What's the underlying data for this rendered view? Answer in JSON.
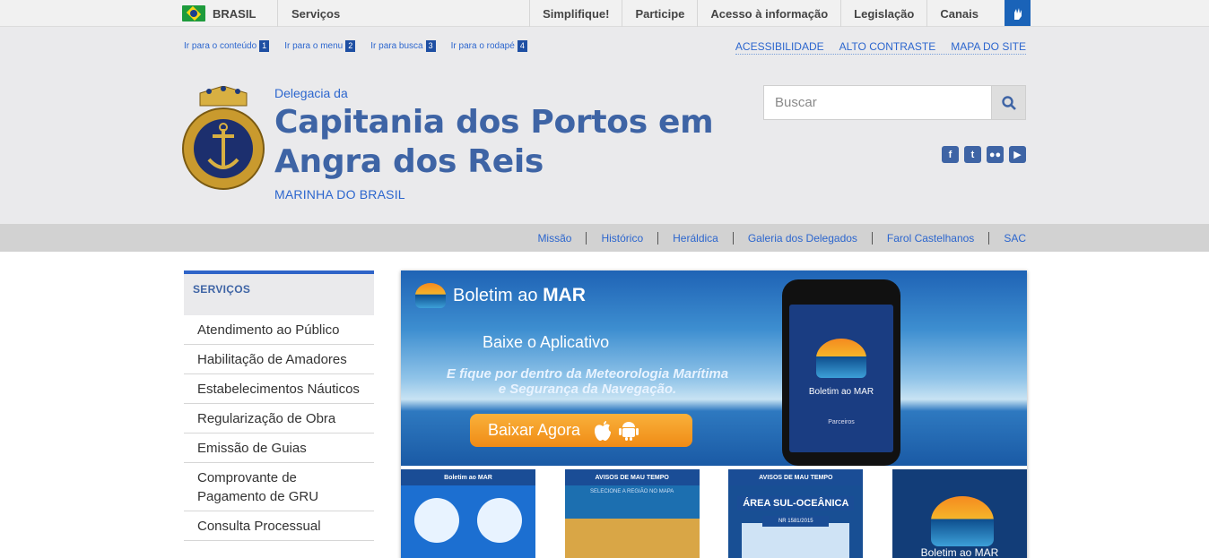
{
  "govbar": {
    "country_label": "BRASIL",
    "services_label": "Serviços",
    "links": [
      "Simplifique!",
      "Participe",
      "Acesso à informação",
      "Legislação",
      "Canais"
    ],
    "accessibility_icon": "sign-language-icon"
  },
  "shortcuts": [
    {
      "label": "Ir para o conteúdo",
      "key": "1"
    },
    {
      "label": "Ir para o menu",
      "key": "2"
    },
    {
      "label": "Ir para busca",
      "key": "3"
    },
    {
      "label": "Ir para o rodapé",
      "key": "4"
    }
  ],
  "accessibility_links": [
    "ACESSIBILIDADE",
    "ALTO CONTRASTE",
    "MAPA DO SITE"
  ],
  "site": {
    "subtitle": "Delegacia da",
    "title_line1": "Capitania dos Portos em",
    "title_line2": "Angra dos Reis",
    "organization": "MARINHA DO BRASIL",
    "logo_icon": "marinha-do-brasil-crest-icon"
  },
  "search": {
    "placeholder": "Buscar",
    "value": "",
    "button_icon": "search-icon"
  },
  "social": [
    {
      "name": "facebook-icon",
      "glyph": "f"
    },
    {
      "name": "twitter-icon",
      "glyph": "t"
    },
    {
      "name": "flickr-icon",
      "glyph": "●●"
    },
    {
      "name": "youtube-icon",
      "glyph": "▶"
    }
  ],
  "subnav": [
    "Missão",
    "Histórico",
    "Heráldica",
    "Galeria dos Delegados",
    "Farol Castelhanos",
    "SAC"
  ],
  "sidebar": {
    "heading": "SERVIÇOS",
    "items": [
      "Atendimento ao Público",
      "Habilitação de Amadores",
      "Estabelecimentos Náuticos",
      "Regularização de Obra",
      "Emissão de Guias",
      "Comprovante de Pagamento de GRU",
      "Consulta Processual"
    ]
  },
  "banner": {
    "brand_prefix": "Boletim ao ",
    "brand_strong": "MAR",
    "download_heading": "Baixe o Aplicativo",
    "description_line1": "E fique por dentro da Meteorologia Marítima",
    "description_line2": "e Segurança da Navegação.",
    "cta_label": "Baixar Agora",
    "phone_app_name": "Boletim ao MAR",
    "phone_partners": "Parceiros",
    "thumb1_title": "Boletim ao MAR",
    "thumb2_title": "AVISOS DE MAU TEMPO",
    "thumb2_sub": "SELECIONE A REGIÃO NO MAPA",
    "thumb3_title": "AVISOS DE MAU TEMPO",
    "thumb3_region": "ÁREA SUL-OCEÂNICA",
    "thumb3_nr": "NR 1581/2015",
    "thumb4_name": "Boletim ao MAR"
  },
  "colors": {
    "brand_blue": "#3e64a5",
    "link_blue": "#2c66ce",
    "govbar_bg": "#f1f1f1",
    "header_bg": "#eaeaec",
    "subnav_bg": "#d2d2d2",
    "sidebar_accent": "#2f64c8"
  }
}
